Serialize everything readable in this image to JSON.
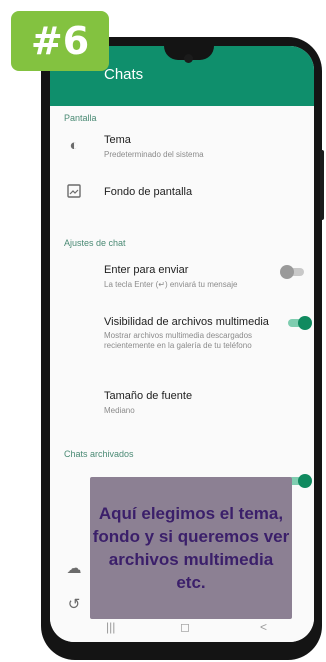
{
  "badge": "#6",
  "header": {
    "title": "Chats"
  },
  "sections": {
    "pantalla": "Pantalla",
    "ajustes": "Ajustes de chat",
    "archivados": "Chats archivados"
  },
  "items": {
    "tema": {
      "title": "Tema",
      "subtitle": "Predeterminado del sistema"
    },
    "fondo": {
      "title": "Fondo de pantalla"
    },
    "enter": {
      "title": "Enter para enviar",
      "subtitle": "La tecla Enter (↵) enviará tu mensaje",
      "enabled": false
    },
    "visibilidad": {
      "title": "Visibilidad de archivos multimedia",
      "subtitle": "Mostrar archivos multimedia descargados recientemente en la galería de tu teléfono",
      "enabled": true
    },
    "tamano": {
      "title": "Tamaño de fuente",
      "subtitle": "Mediano"
    },
    "archivados_toggle": {
      "enabled": true
    }
  },
  "overlay": {
    "text": "Aquí elegimos el tema, fondo y si queremos ver archivos multimedia etc."
  },
  "navbar": {
    "recent": "|||",
    "home": "◻",
    "back": "<"
  },
  "colors": {
    "appbar": "#0f8f6c",
    "accent": "#108a5f",
    "badge": "#83c240",
    "overlay": "#8c8093"
  }
}
